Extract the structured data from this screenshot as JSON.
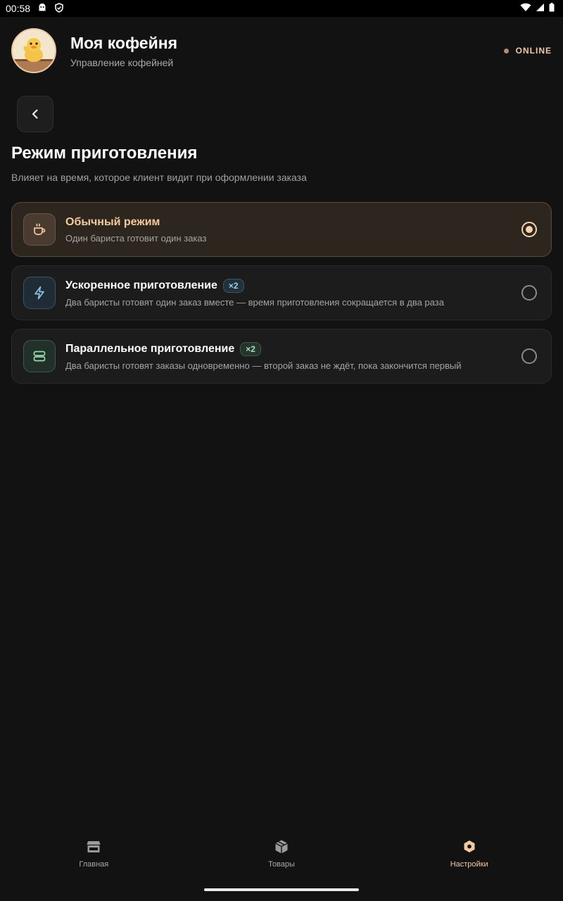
{
  "status_bar": {
    "time": "00:58"
  },
  "header": {
    "title": "Моя кофейня",
    "subtitle": "Управление кофейней",
    "status": "ONLINE"
  },
  "page": {
    "title": "Режим приготовления",
    "subtitle": "Влияет на время, которое клиент видит при оформлении заказа"
  },
  "options": [
    {
      "title": "Обычный режим",
      "desc": "Один бариста готовит один заказ",
      "badge": "",
      "selected": true,
      "icon": "coffee-cup-icon"
    },
    {
      "title": "Ускоренное приготовление",
      "desc": "Два баристы готовят один заказ вместе — время приготовления сокращается в два раза",
      "badge": "×2",
      "selected": false,
      "icon": "lightning-icon"
    },
    {
      "title": "Параллельное приготовление",
      "desc": "Два баристы готовят заказы одновременно — второй заказ не ждёт, пока закончится первый",
      "badge": "×2",
      "selected": false,
      "icon": "parallel-stack-icon"
    }
  ],
  "nav": [
    {
      "label": "Главная",
      "icon": "store-icon"
    },
    {
      "label": "Товары",
      "icon": "box-icon"
    },
    {
      "label": "Настройки",
      "icon": "gear-icon",
      "active": true
    }
  ],
  "colors": {
    "accent": "#f3c9a0",
    "background": "#121212",
    "card": "#1c1c1c",
    "selected_card": "#2d261f"
  }
}
